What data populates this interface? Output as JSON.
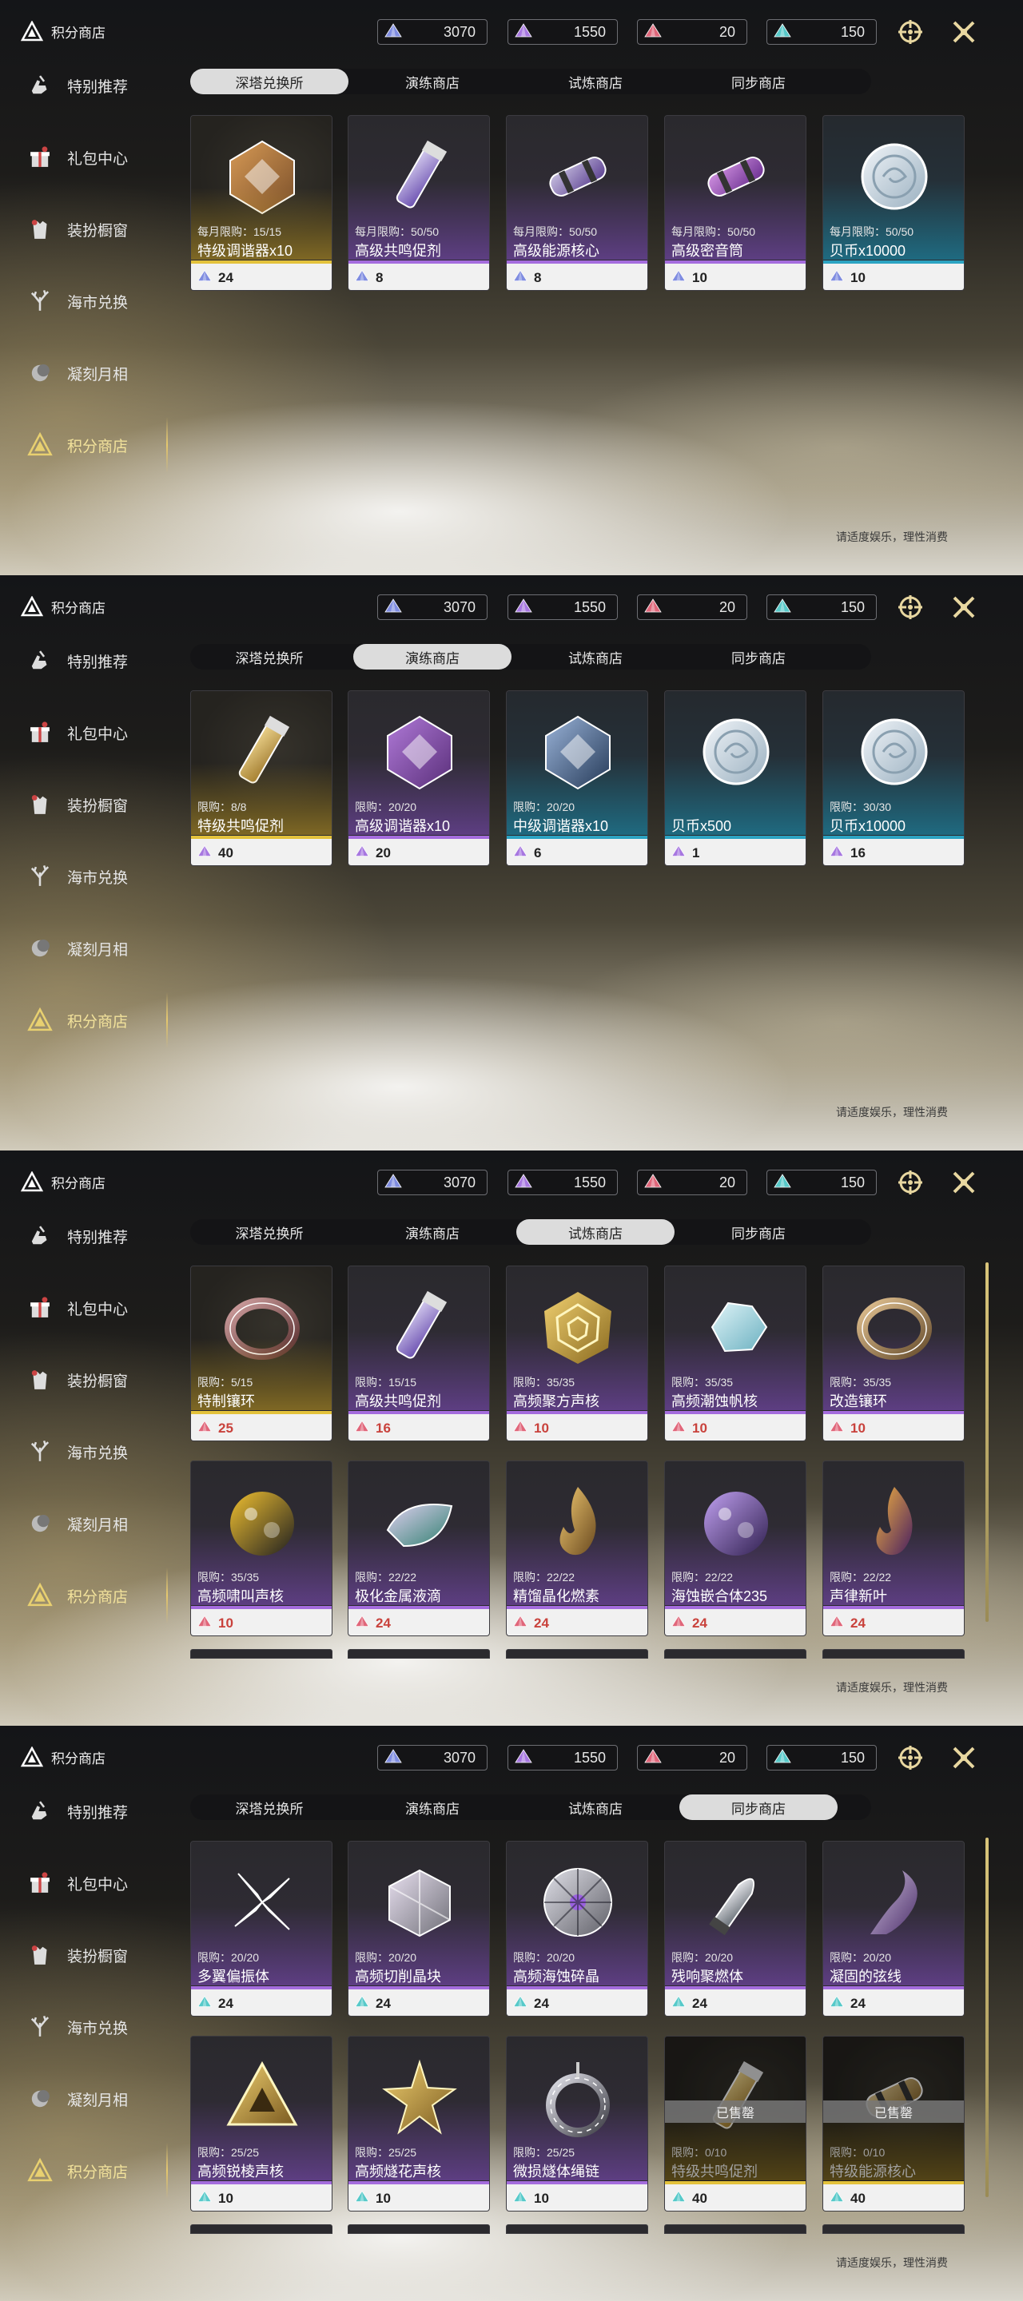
{
  "page_title": "积分商店",
  "resources": [
    {
      "color": "#7f8ce0",
      "value": "3070"
    },
    {
      "color": "#a777e0",
      "value": "1550"
    },
    {
      "color": "#e0667a",
      "value": "20"
    },
    {
      "color": "#57c9c9",
      "value": "150"
    }
  ],
  "sidebar": [
    {
      "label": "特别推荐",
      "icon": "hand-icon"
    },
    {
      "label": "礼包中心",
      "icon": "gift-icon"
    },
    {
      "label": "装扮橱窗",
      "icon": "outfit-icon"
    },
    {
      "label": "海市兑换",
      "icon": "coral-icon"
    },
    {
      "label": "凝刻月相",
      "icon": "moon-icon"
    },
    {
      "label": "积分商店",
      "icon": "points-triangle-icon"
    }
  ],
  "tabs": [
    "深塔兑换所",
    "演练商店",
    "试炼商店",
    "同步商店"
  ],
  "footer_note": "请适度娱乐，理性消费",
  "sold_label": "已售罄",
  "panels": [
    {
      "active_tab": 0,
      "items": [
        {
          "limit": "每月限购：15/15",
          "name": "特级调谐器x10",
          "price": "24",
          "tier": "gold",
          "cur": "blue",
          "art": "octa-orange"
        },
        {
          "limit": "每月限购：50/50",
          "name": "高级共鸣促剂",
          "price": "8",
          "tier": "purple",
          "cur": "blue",
          "art": "vial-purple"
        },
        {
          "limit": "每月限购：50/50",
          "name": "高级能源核心",
          "price": "8",
          "tier": "purple",
          "cur": "blue",
          "art": "capsule-purple"
        },
        {
          "limit": "每月限购：50/50",
          "name": "高级密音筒",
          "price": "10",
          "tier": "purple",
          "cur": "blue",
          "art": "cylinder-purple"
        },
        {
          "limit": "每月限购：50/50",
          "name": "贝币x10000",
          "price": "10",
          "tier": "blue",
          "cur": "blue",
          "art": "coin"
        }
      ]
    },
    {
      "active_tab": 1,
      "items": [
        {
          "limit": "限购：8/8",
          "name": "特级共鸣促剂",
          "price": "40",
          "tier": "gold",
          "cur": "purple",
          "art": "vial-gold"
        },
        {
          "limit": "限购：20/20",
          "name": "高级调谐器x10",
          "price": "20",
          "tier": "purple",
          "cur": "purple",
          "art": "octa-purple"
        },
        {
          "limit": "限购：20/20",
          "name": "中级调谐器x10",
          "price": "6",
          "tier": "blue",
          "cur": "purple",
          "art": "octa-blue"
        },
        {
          "limit": "",
          "name": "贝币x500",
          "price": "1",
          "tier": "blue",
          "cur": "purple",
          "art": "coin"
        },
        {
          "limit": "限购：30/30",
          "name": "贝币x10000",
          "price": "16",
          "tier": "blue",
          "cur": "purple",
          "art": "coin"
        }
      ]
    },
    {
      "active_tab": 2,
      "items": [
        {
          "limit": "限购：5/15",
          "name": "特制镶环",
          "price": "25",
          "tier": "gold",
          "cur": "red",
          "art": "ring-red"
        },
        {
          "limit": "限购：15/15",
          "name": "高级共鸣促剂",
          "price": "16",
          "tier": "purple",
          "cur": "red",
          "art": "vial-purple"
        },
        {
          "limit": "限购：35/35",
          "name": "高频聚方声核",
          "price": "10",
          "tier": "purple",
          "cur": "red",
          "art": "spiral-gold"
        },
        {
          "limit": "限购：35/35",
          "name": "高频潮蚀帆核",
          "price": "10",
          "tier": "purple",
          "cur": "red",
          "art": "crystal-cyan"
        },
        {
          "limit": "限购：35/35",
          "name": "改造镶环",
          "price": "10",
          "tier": "purple",
          "cur": "red",
          "art": "ring-gold"
        },
        {
          "limit": "限购：35/35",
          "name": "高频啸叫声核",
          "price": "10",
          "tier": "purple",
          "cur": "red",
          "art": "orb-yellow"
        },
        {
          "limit": "限购：22/22",
          "name": "极化金属液滴",
          "price": "24",
          "tier": "purple",
          "cur": "red",
          "art": "drop-rainbow"
        },
        {
          "limit": "限购：22/22",
          "name": "精馏晶化燃素",
          "price": "24",
          "tier": "purple",
          "cur": "red",
          "art": "flame-gold"
        },
        {
          "limit": "限购：22/22",
          "name": "海蚀嵌合体235",
          "price": "24",
          "tier": "purple",
          "cur": "red",
          "art": "orb-violet"
        },
        {
          "limit": "限购：22/22",
          "name": "声律新叶",
          "price": "24",
          "tier": "purple",
          "cur": "red",
          "art": "flame-purple"
        }
      ]
    },
    {
      "active_tab": 3,
      "items": [
        {
          "limit": "限购：20/20",
          "name": "多翼偏振体",
          "price": "24",
          "tier": "purple",
          "cur": "cyan",
          "art": "flower-silver"
        },
        {
          "limit": "限购：20/20",
          "name": "高频切削晶块",
          "price": "24",
          "tier": "purple",
          "cur": "cyan",
          "art": "cube-silver"
        },
        {
          "limit": "限购：20/20",
          "name": "高频海蚀碎晶",
          "price": "24",
          "tier": "purple",
          "cur": "cyan",
          "art": "disc-silver"
        },
        {
          "limit": "限购：20/20",
          "name": "残响聚燃体",
          "price": "24",
          "tier": "purple",
          "cur": "cyan",
          "art": "bullet-silver"
        },
        {
          "limit": "限购：20/20",
          "name": "凝固的弦线",
          "price": "24",
          "tier": "purple",
          "cur": "cyan",
          "art": "wisp-purple"
        },
        {
          "limit": "限购：25/25",
          "name": "高频锐棱声核",
          "price": "10",
          "tier": "purple",
          "cur": "cyan",
          "art": "triangle-gold"
        },
        {
          "limit": "限购：25/25",
          "name": "高频燧花声核",
          "price": "10",
          "tier": "purple",
          "cur": "cyan",
          "art": "star-gold"
        },
        {
          "limit": "限购：25/25",
          "name": "微损燧体绳链",
          "price": "10",
          "tier": "purple",
          "cur": "cyan",
          "art": "chain-silver"
        },
        {
          "limit": "限购：0/10",
          "name": "特级共鸣促剂",
          "price": "40",
          "tier": "gold",
          "cur": "cyan",
          "art": "vial-gold",
          "sold": true
        },
        {
          "limit": "限购：0/10",
          "name": "特级能源核心",
          "price": "40",
          "tier": "gold",
          "cur": "cyan",
          "art": "capsule-gold",
          "sold": true
        }
      ]
    }
  ]
}
